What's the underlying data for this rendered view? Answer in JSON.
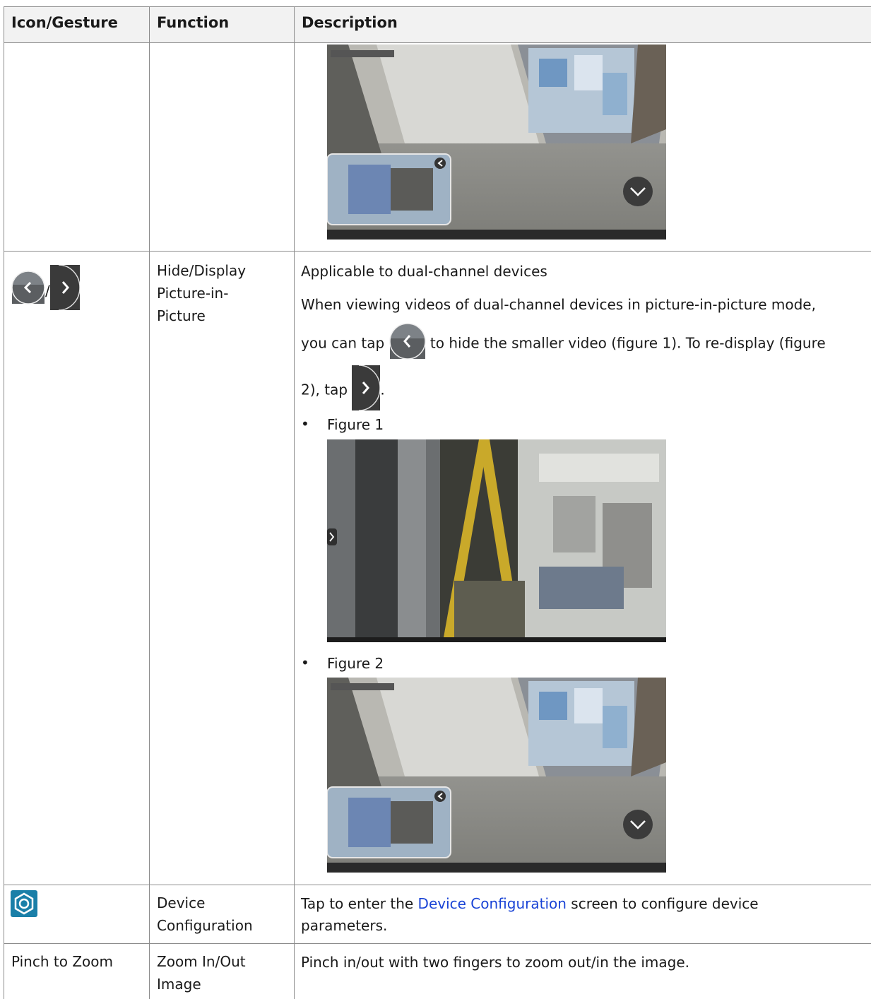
{
  "table": {
    "headers": [
      "Icon/Gesture",
      "Function",
      "Description"
    ],
    "rows": [
      {
        "function_lines": [
          "Hide/Display",
          "Picture-in-",
          "Picture"
        ],
        "desc": {
          "line1": "Applicable to dual-channel devices",
          "line2": "When viewing videos of dual-channel devices in picture-in-picture mode,",
          "line3a": "you can tap",
          "line3b": "to hide the smaller video (figure 1). To re-display (figure",
          "line4a": "2), tap",
          "line4b": ".",
          "bullet1": "Figure 1",
          "bullet2": "Figure 2",
          "bullet_char": "•"
        },
        "icons": [
          "pip-hide-icon",
          "pip-show-icon"
        ],
        "separator": "/"
      },
      {
        "function_lines": [
          "Device",
          "Configuration"
        ],
        "desc": {
          "before": "Tap to enter the ",
          "link": "Device Configuration",
          "after": " screen to configure device",
          "line2": "parameters."
        },
        "icons": [
          "settings-hexagon-icon"
        ]
      },
      {
        "icon_text": "Pinch to Zoom",
        "function_lines": [
          "Zoom In/Out",
          "Image"
        ],
        "desc": {
          "line1": "Pinch in/out with two fingers to zoom out/in the image."
        }
      }
    ]
  },
  "colors": {
    "link": "#1a44d6",
    "header_bg": "#f2f2f2",
    "icon_teal": "#1a7fa8"
  }
}
